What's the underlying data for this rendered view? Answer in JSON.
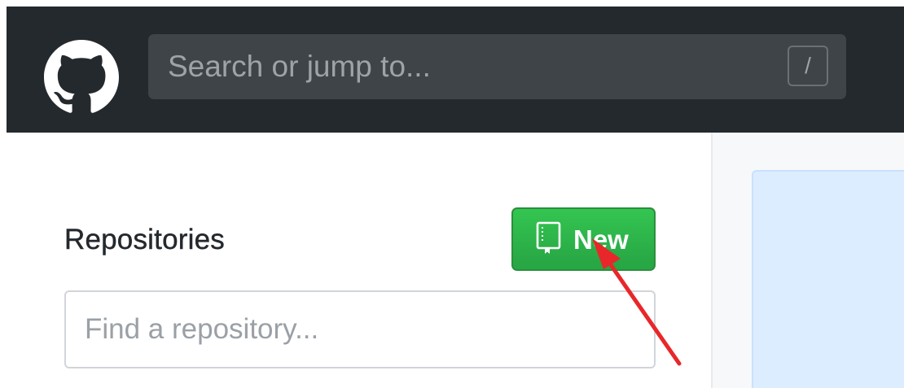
{
  "header": {
    "logo_icon": "github-octocat-icon",
    "search": {
      "placeholder": "Search or jump to...",
      "shortcut_key": "/"
    }
  },
  "sidebar": {
    "title": "Repositories",
    "new_button": {
      "label": "New",
      "icon": "repo-book-icon"
    },
    "find_input": {
      "placeholder": "Find a repository..."
    }
  },
  "annotation": {
    "arrow_icon": "red-arrow-icon",
    "color": "#e8272a"
  },
  "colors": {
    "header_bg": "#24292e",
    "button_green": "#28a745",
    "panel_blue": "#dbedff"
  }
}
